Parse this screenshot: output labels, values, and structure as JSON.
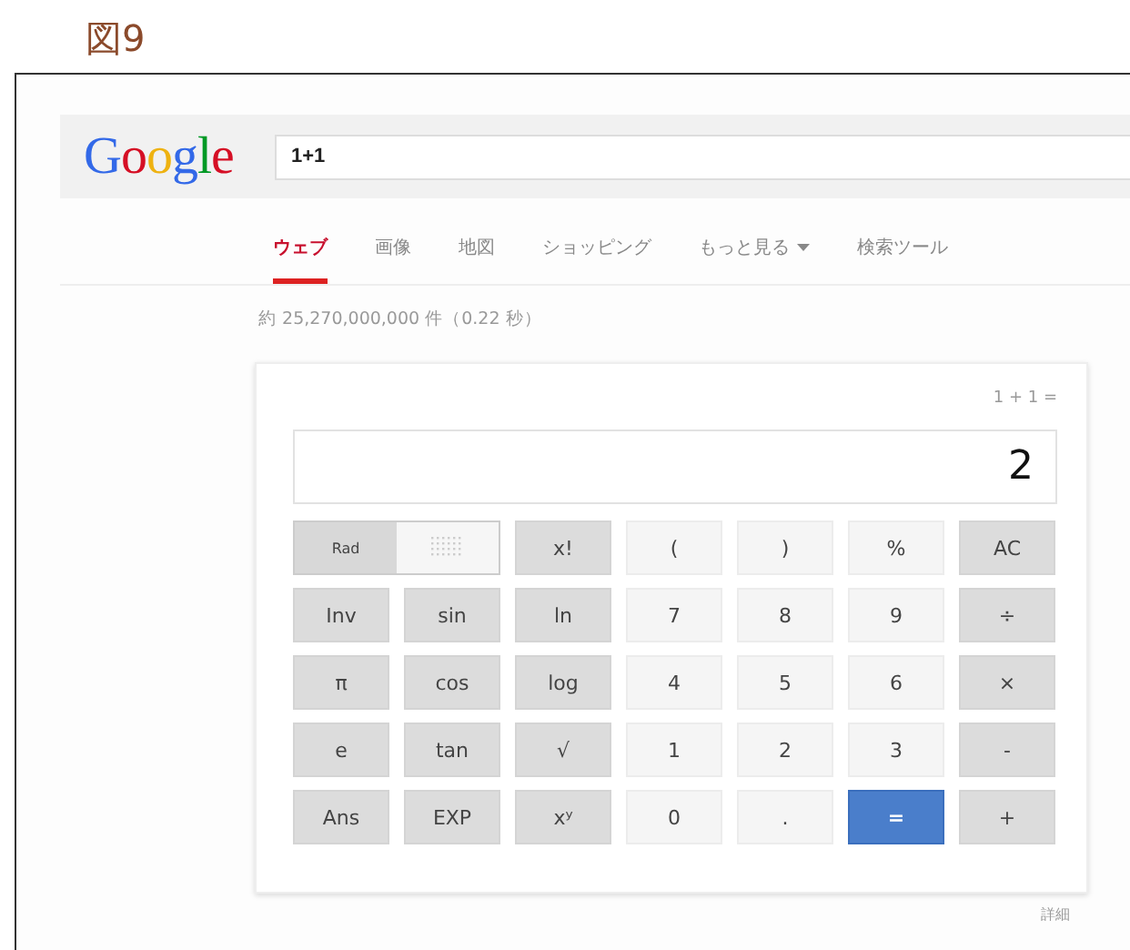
{
  "caption": "図9",
  "logo": "Google",
  "search": {
    "value": "1+1"
  },
  "tabs": [
    {
      "label": "ウェブ",
      "selected": true,
      "menu": false
    },
    {
      "label": "画像",
      "selected": false,
      "menu": false
    },
    {
      "label": "地図",
      "selected": false,
      "menu": false
    },
    {
      "label": "ショッピング",
      "selected": false,
      "menu": false
    },
    {
      "label": "もっと見る",
      "selected": false,
      "menu": true
    },
    {
      "label": "検索ツール",
      "selected": false,
      "menu": false
    }
  ],
  "result_stats": "約 25,270,000,000 件（0.22 秒）",
  "calculator": {
    "expression": "1 + 1 =",
    "display": "2",
    "angle_toggle": [
      {
        "label": "Rad",
        "selected": true
      },
      {
        "selected": false
      }
    ],
    "keys": [
      {
        "label": "x!",
        "kind": "fn"
      },
      {
        "label": "(",
        "kind": "num"
      },
      {
        "label": ")",
        "kind": "num"
      },
      {
        "label": "%",
        "kind": "num"
      },
      {
        "label": "AC",
        "kind": "fn"
      },
      {
        "label": "Inv",
        "kind": "fn"
      },
      {
        "label": "sin",
        "kind": "fn"
      },
      {
        "label": "ln",
        "kind": "fn"
      },
      {
        "label": "7",
        "kind": "num"
      },
      {
        "label": "8",
        "kind": "num"
      },
      {
        "label": "9",
        "kind": "num"
      },
      {
        "label": "÷",
        "kind": "fn"
      },
      {
        "label": "π",
        "kind": "fn"
      },
      {
        "label": "cos",
        "kind": "fn"
      },
      {
        "label": "log",
        "kind": "fn"
      },
      {
        "label": "4",
        "kind": "num"
      },
      {
        "label": "5",
        "kind": "num"
      },
      {
        "label": "6",
        "kind": "num"
      },
      {
        "label": "×",
        "kind": "fn"
      },
      {
        "label": "e",
        "kind": "fn"
      },
      {
        "label": "tan",
        "kind": "fn"
      },
      {
        "label": "√",
        "kind": "fn"
      },
      {
        "label": "1",
        "kind": "num"
      },
      {
        "label": "2",
        "kind": "num"
      },
      {
        "label": "3",
        "kind": "num"
      },
      {
        "label": "-",
        "kind": "fn"
      },
      {
        "label": "Ans",
        "kind": "fn"
      },
      {
        "label": "EXP",
        "kind": "fn"
      },
      {
        "label": "xʸ",
        "kind": "fn"
      },
      {
        "label": "0",
        "kind": "num"
      },
      {
        "label": ".",
        "kind": "num"
      },
      {
        "label": "=",
        "kind": "eq"
      },
      {
        "label": "+",
        "kind": "fn"
      }
    ],
    "details_link": "詳細"
  }
}
